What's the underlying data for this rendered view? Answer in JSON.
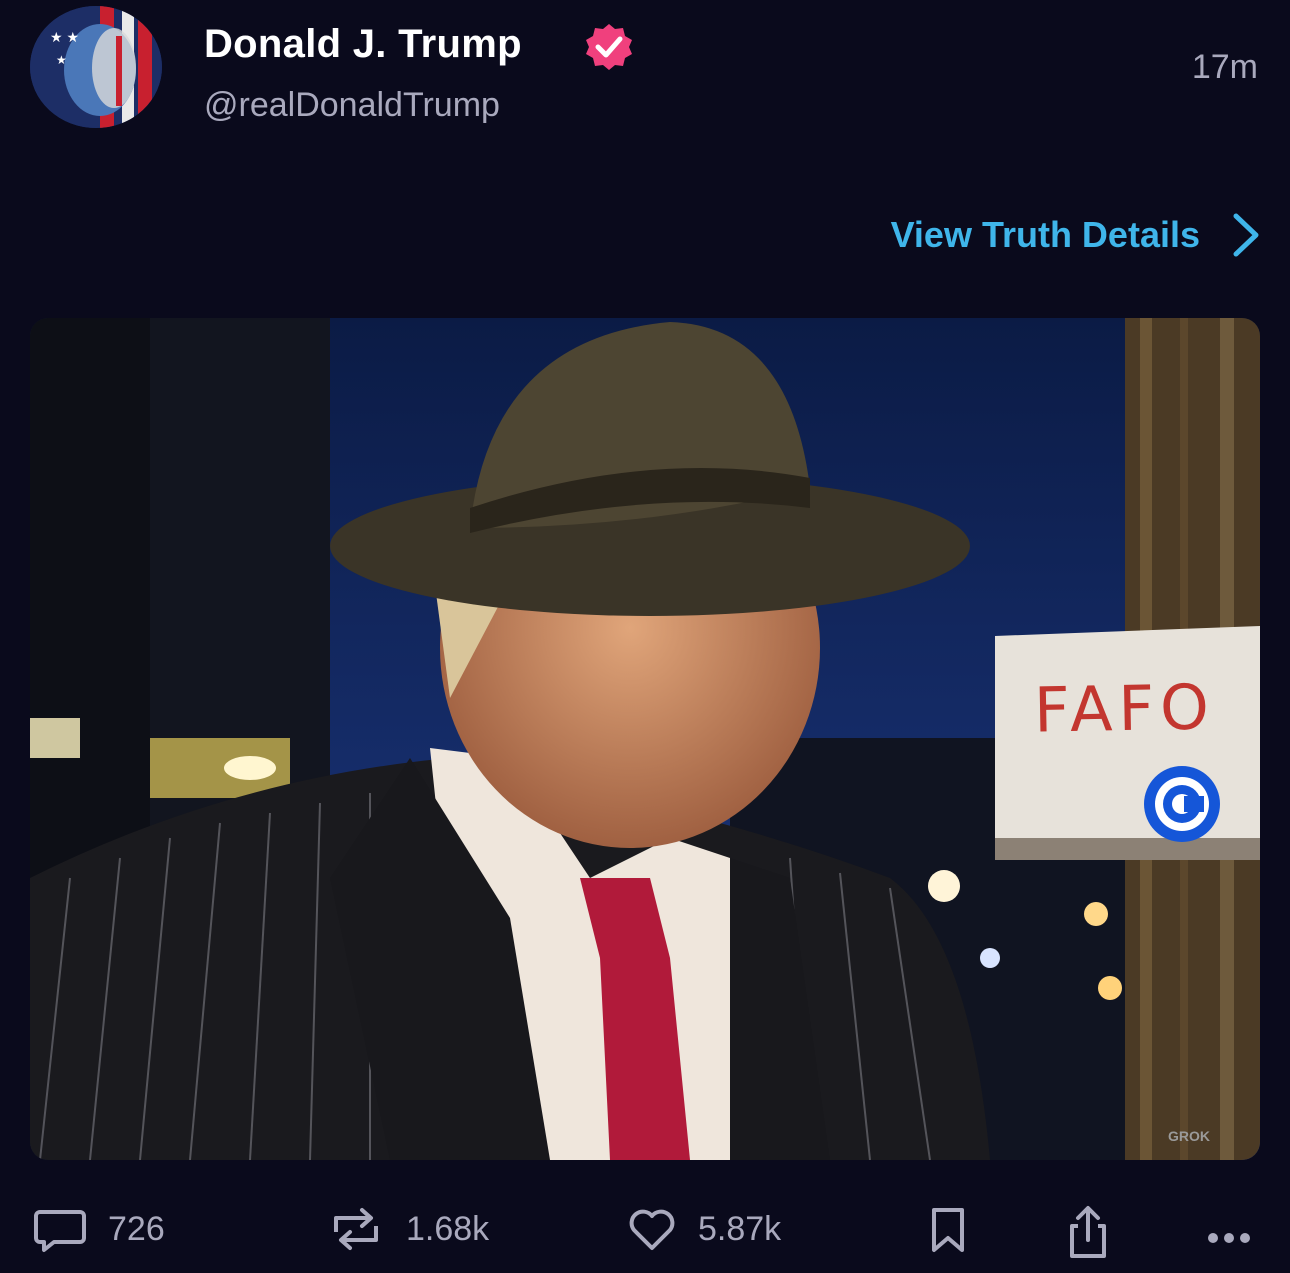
{
  "post": {
    "author": {
      "display_name": "Donald J. Trump",
      "handle": "@realDonaldTrump",
      "verified": true,
      "verified_icon": "verified-badge-icon",
      "badge_color": "#f0407d"
    },
    "timestamp": "17m",
    "view_details_label": "View Truth Details",
    "media": {
      "sign_text": "FAFO",
      "watermark": "GROK",
      "badge_icon": "circle-c-logo-icon"
    },
    "actions": {
      "replies": "726",
      "reposts": "1.68k",
      "likes": "5.87k",
      "bookmark_icon": "bookmark-icon",
      "share_icon": "share-icon",
      "more_icon": "more-icon"
    }
  },
  "colors": {
    "background": "#0a0a1c",
    "link": "#3fb5ea",
    "secondary_text": "#a9a9bd"
  }
}
